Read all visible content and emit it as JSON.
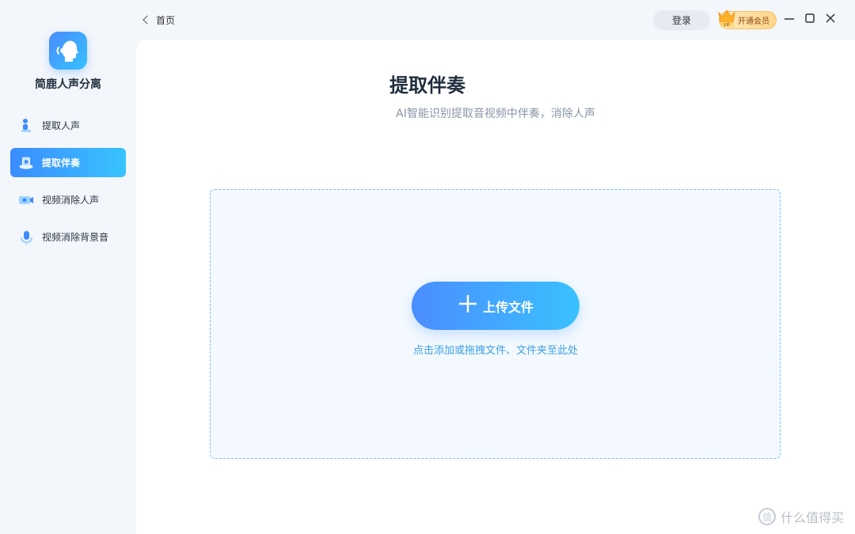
{
  "app": {
    "name": "简鹿人声分离"
  },
  "topbar": {
    "back_label": "首页",
    "login_label": "登录",
    "vip_label": "开通会员",
    "vip_badge": "VIP"
  },
  "sidebar": {
    "items": [
      {
        "label": "提取人声",
        "icon": "microphone-person-icon",
        "active": false
      },
      {
        "label": "提取伴奏",
        "icon": "accompany-icon",
        "active": true
      },
      {
        "label": "视频消除人声",
        "icon": "video-mute-icon",
        "active": false
      },
      {
        "label": "视频消除背景音",
        "icon": "video-bg-mute-icon",
        "active": false
      }
    ]
  },
  "main": {
    "title": "提取伴奏",
    "subtitle": "AI智能识别提取音视频中伴奏，消除人声",
    "upload_label": "上传文件",
    "hint": "点击添加或拖拽文件、文件夹至此处"
  },
  "watermark": {
    "text": "什么值得买",
    "icon_char": "值"
  },
  "colors": {
    "accent_start": "#3b8cff",
    "accent_end": "#38c3ff",
    "hint": "#3aa0e8"
  }
}
